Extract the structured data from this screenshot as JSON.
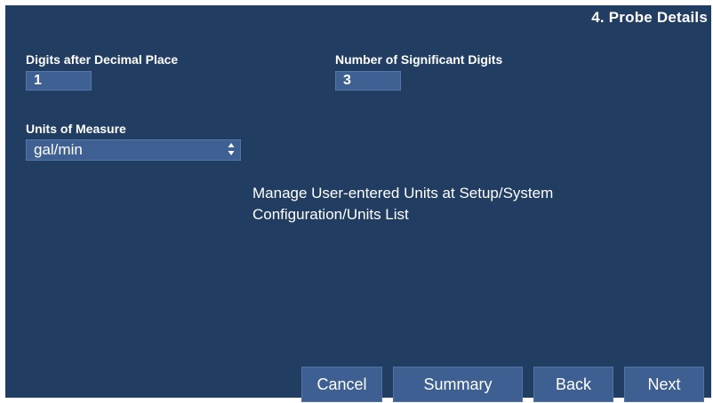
{
  "page": {
    "title": "4. Probe Details"
  },
  "fields": {
    "decimal_label": "Digits after Decimal Place",
    "decimal_value": "1",
    "sig_label": "Number of Significant Digits",
    "sig_value": "3",
    "units_label": "Units of Measure",
    "units_value": "gal/min"
  },
  "note": {
    "line1": "Manage User-entered Units at Setup/System",
    "line2": "Configuration/Units List"
  },
  "buttons": {
    "cancel": "Cancel",
    "summary": "Summary",
    "back": "Back",
    "next": "Next"
  },
  "icons": {
    "select_arrows": "updown-arrows-icon"
  },
  "colors": {
    "panel_bg": "#213d62",
    "field_bg": "#3e6093",
    "button_bg": "#3d5f92"
  }
}
